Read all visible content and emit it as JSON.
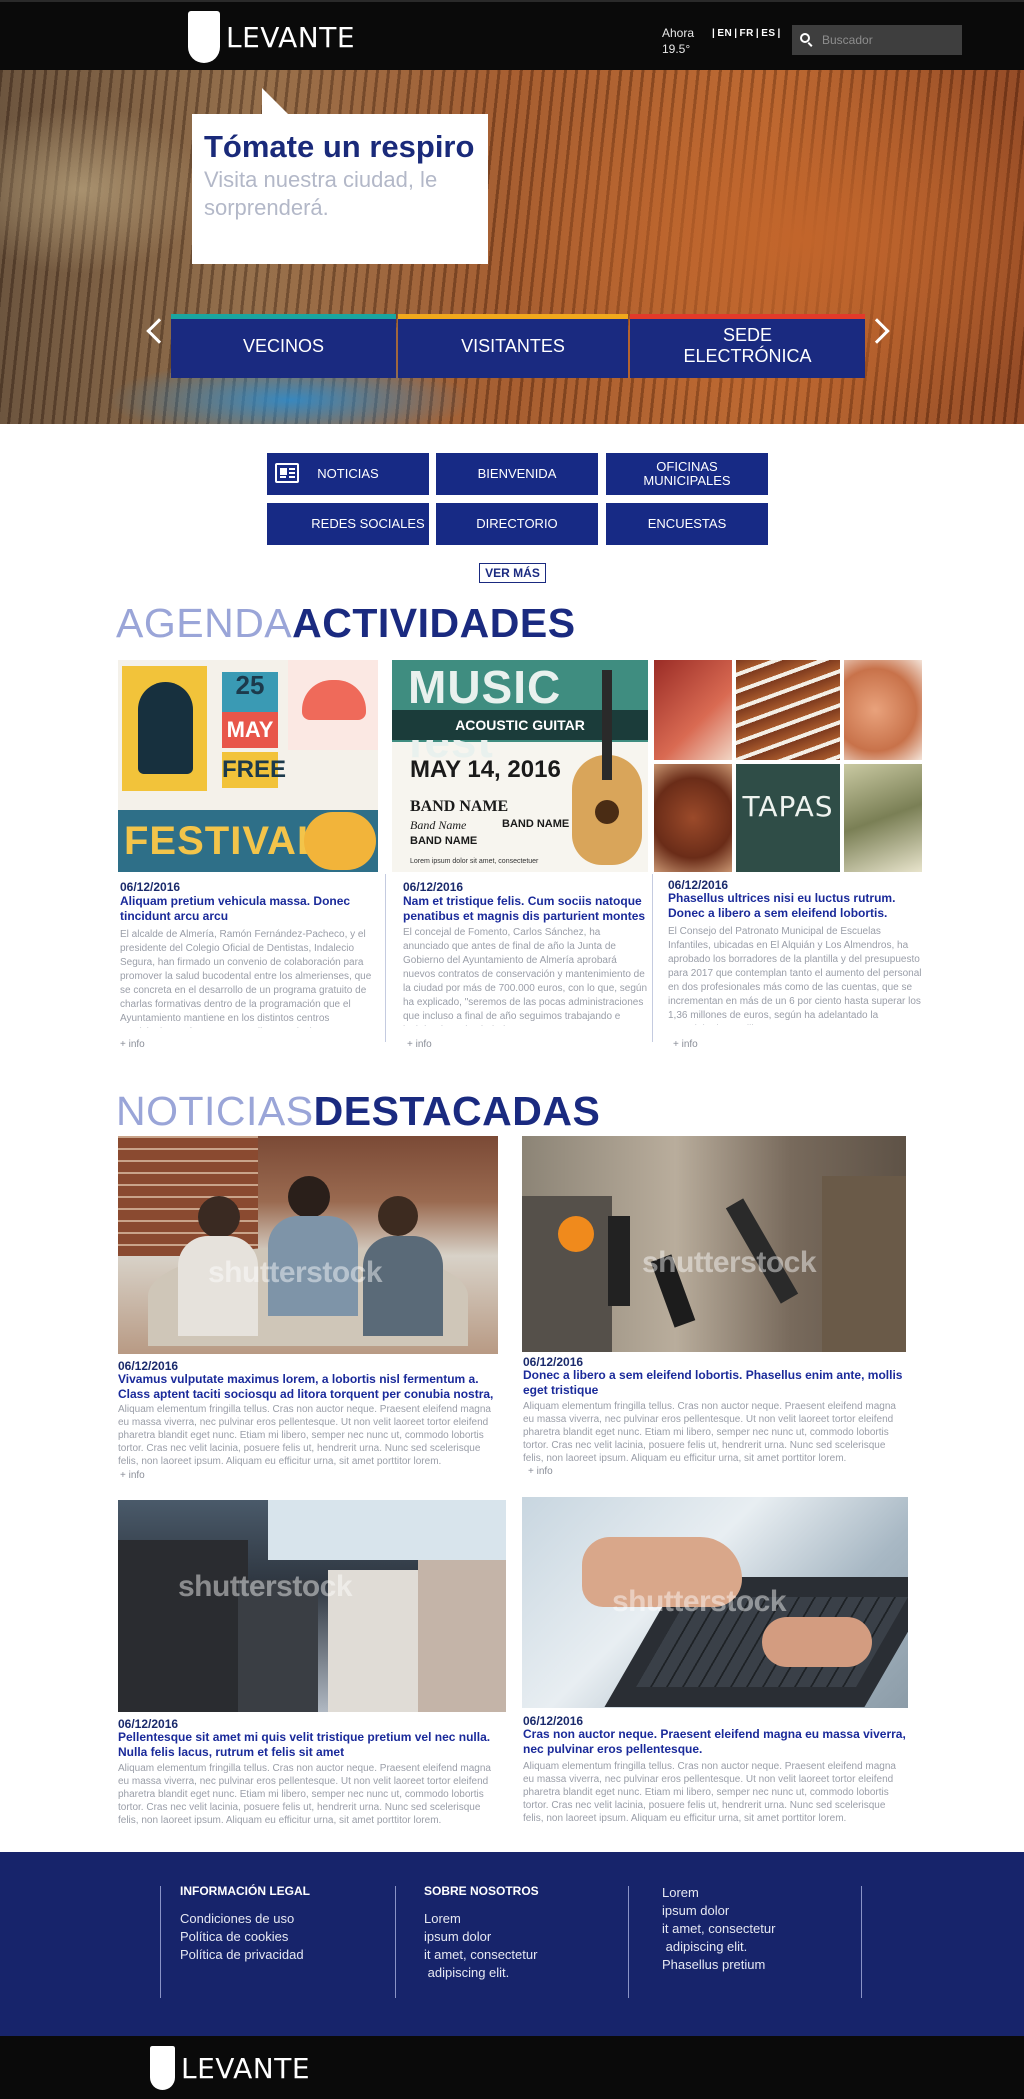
{
  "header": {
    "brand": "LEVANTE",
    "weather_label": "Ahora",
    "weather_temp": "19.5°",
    "languages": [
      "EN",
      "FR",
      "ES"
    ],
    "search_placeholder": "Buscador"
  },
  "hero": {
    "title": "Tómate un respiro",
    "subtitle": "Visita nuestra ciudad, le sorprenderá.",
    "buttons": [
      {
        "label": "VECINOS",
        "accent": "#1aa6a0"
      },
      {
        "label": "VISITANTES",
        "accent": "#f0a81c"
      },
      {
        "label": "SEDE ELECTRÓNICA",
        "accent": "#e23a2a"
      }
    ]
  },
  "quick_links": [
    "NOTICIAS",
    "BIENVENIDA",
    "OFICINAS MUNICIPALES",
    "REDES SOCIALES",
    "DIRECTORIO",
    "ENCUESTAS"
  ],
  "ver_mas": "VER MÁS",
  "agenda": {
    "title_light": "AGENDA",
    "title_bold": "ACTIVIDADES",
    "items": [
      {
        "date": "06/12/2016",
        "title": "Aliquam pretium vehicula massa. Donec tincidunt arcu arcu",
        "text": "El alcalde de Almería, Ramón Fernández-Pacheco, y el presidente del Colegio Oficial de Dentistas, Indalecio Segura, han firmado un convenio de colaboración para promover la salud bucodental entre los almerienses, que se concreta en el desarrollo de un programa gratuito de charlas formativas dentro de la programación que el Ayuntamiento mantiene en los distintos centros municipales, así como en aquellas asociaciones.",
        "more": "+ info",
        "poster": {
          "day": "25",
          "month": "MAY",
          "free": "FREE",
          "name": "FESTIVAL"
        }
      },
      {
        "date": "06/12/2016",
        "title": "Nam et tristique felis. Cum sociis natoque penatibus et magnis dis parturient montes",
        "text": "El concejal de Fomento, Carlos Sánchez, ha anunciado que antes de final de año la Junta de Gobierno del Ayuntamiento de Almería aprobará nuevos contratos de conservación y mantenimiento de la ciudad por más de 700.000 euros, con lo que, según ha explicado, \"seremos de las pocas administraciones que incluso a final de año seguimos trabajando e invirtiendo en la ciudad\".",
        "more": "+ info",
        "poster": {
          "name": "MUSIC fest",
          "sub": "ACOUSTIC GUITAR",
          "date": "MAY 14, 2016",
          "band1": "BAND NAME",
          "band2": "Band Name",
          "band3": "BAND NAME",
          "band4": "BAND NAME",
          "small": "Lorem ipsum dolor sit amet, consectetuer"
        }
      },
      {
        "date": "06/12/2016",
        "title": "Phasellus ultrices nisi eu luctus rutrum. Donec a libero a sem eleifend lobortis.",
        "text": "El Consejo del Patronato Municipal de Escuelas Infantiles, ubicadas en El Alquián y Los Almendros, ha aprobado los borradores de la plantilla y del presupuesto para 2017 que contemplan tanto el aumento del personal en dos profesionales más como de las cuentas, que se incrementan en más de un 6 por ciento hasta superar los 1,36 millones de euros, según ha adelantado la concejala de Familia e",
        "more": "+ info",
        "poster": {
          "board": "TAPAS"
        }
      }
    ]
  },
  "news": {
    "title_light": "NOTICIAS",
    "title_bold": "DESTACADAS",
    "watermark": "shutterstock",
    "items": [
      {
        "date": "06/12/2016",
        "title": "Vivamus vulputate maximus lorem, a lobortis nisl fermentum a. Class aptent taciti sociosqu ad litora torquent per conubia nostra,",
        "text": "Aliquam elementum fringilla tellus. Cras non auctor neque. Praesent eleifend magna eu massa viverra, nec pulvinar eros pellentesque. Ut non velit laoreet tortor eleifend pharetra blandit eget nunc. Etiam mi libero, semper nec nunc ut, commodo lobortis tortor. Cras nec velit lacinia, posuere felis ut, hendrerit urna. Nunc sed scelerisque felis, non laoreet ipsum. Aliquam eu efficitur urna, sit amet porttitor lorem.",
        "more": "+ info"
      },
      {
        "date": "06/12/2016",
        "title": "Donec a libero a sem eleifend lobortis. Phasellus enim ante, mollis eget tristique",
        "text": "Aliquam elementum fringilla tellus. Cras non auctor neque. Praesent eleifend magna eu massa viverra, nec pulvinar eros pellentesque. Ut non velit laoreet tortor eleifend pharetra blandit eget nunc. Etiam mi libero, semper nec nunc ut, commodo lobortis tortor. Cras nec velit lacinia, posuere felis ut, hendrerit urna. Nunc sed scelerisque felis, non laoreet ipsum. Aliquam eu efficitur urna, sit amet porttitor lorem.",
        "more": "+ info"
      },
      {
        "date": "06/12/2016",
        "title": "Pellentesque sit amet mi quis velit tristique pretium vel nec nulla. Nulla felis lacus, rutrum et felis sit amet",
        "text": "Aliquam elementum fringilla tellus. Cras non auctor neque. Praesent eleifend magna eu massa viverra, nec pulvinar eros pellentesque. Ut non velit laoreet tortor eleifend pharetra blandit eget nunc. Etiam mi libero, semper nec nunc ut, commodo lobortis tortor. Cras nec velit lacinia, posuere felis ut, hendrerit urna. Nunc sed scelerisque felis, non laoreet ipsum. Aliquam eu efficitur urna, sit amet porttitor lorem."
      },
      {
        "date": "06/12/2016",
        "title": "Cras non auctor neque. Praesent eleifend magna eu massa viverra, nec pulvinar eros pellentesque.",
        "text": "Aliquam elementum fringilla tellus. Cras non auctor neque. Praesent eleifend magna eu massa viverra, nec pulvinar eros pellentesque. Ut non velit laoreet tortor eleifend pharetra blandit eget nunc. Etiam mi libero, semper nec nunc ut, commodo lobortis tortor. Cras nec velit lacinia, posuere felis ut, hendrerit urna. Nunc sed scelerisque felis, non laoreet ipsum. Aliquam eu efficitur urna, sit amet porttitor lorem."
      }
    ]
  },
  "footer": {
    "legal_heading": "INFORMACIÓN  LEGAL",
    "legal_links": [
      "Condiciones de uso",
      "Política de cookies",
      "Política de privacidad"
    ],
    "about_heading": "SOBRE NOSOTROS",
    "about_lines": [
      "Lorem",
      "ipsum dolor",
      "it amet, consectetur",
      " adipiscing elit."
    ],
    "third_lines": [
      "Lorem",
      "ipsum dolor",
      "it amet, consectetur",
      " adipiscing elit.",
      "Phasellus pretium"
    ],
    "brand": "LEVANTE"
  }
}
